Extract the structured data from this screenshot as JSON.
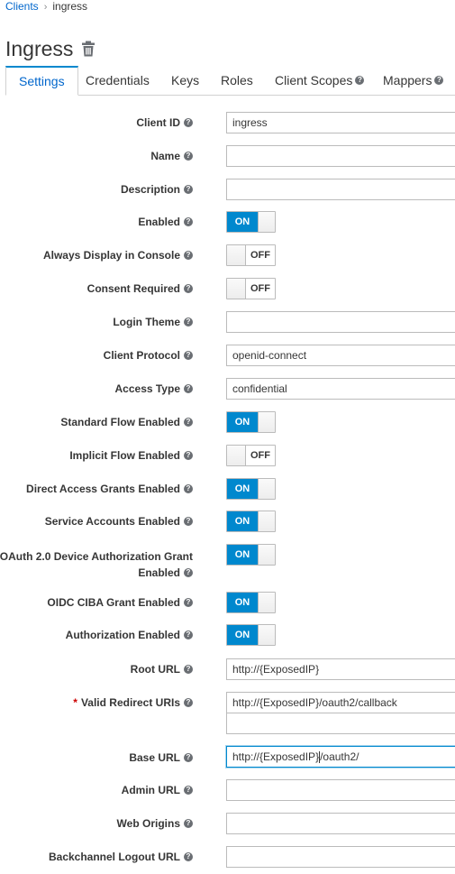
{
  "breadcrumb": {
    "parent": "Clients",
    "separator": "›",
    "current": "ingress"
  },
  "page": {
    "title": "Ingress"
  },
  "tabs": [
    {
      "label": "Settings",
      "active": true
    },
    {
      "label": "Credentials"
    },
    {
      "label": "Keys"
    },
    {
      "label": "Roles"
    },
    {
      "label": "Client Scopes",
      "help": true
    },
    {
      "label": "Mappers",
      "help": true
    }
  ],
  "help_glyph": "?",
  "form": {
    "client_id": {
      "label": "Client ID",
      "value": "ingress"
    },
    "name": {
      "label": "Name",
      "value": ""
    },
    "description": {
      "label": "Description",
      "value": ""
    },
    "enabled": {
      "label": "Enabled",
      "state": "ON"
    },
    "always_display": {
      "label": "Always Display in Console",
      "state": "OFF"
    },
    "consent_required": {
      "label": "Consent Required",
      "state": "OFF"
    },
    "login_theme": {
      "label": "Login Theme",
      "value": ""
    },
    "client_protocol": {
      "label": "Client Protocol",
      "value": "openid-connect"
    },
    "access_type": {
      "label": "Access Type",
      "value": "confidential"
    },
    "standard_flow": {
      "label": "Standard Flow Enabled",
      "state": "ON"
    },
    "implicit_flow": {
      "label": "Implicit Flow Enabled",
      "state": "OFF"
    },
    "direct_access": {
      "label": "Direct Access Grants Enabled",
      "state": "ON"
    },
    "service_accounts": {
      "label": "Service Accounts Enabled",
      "state": "ON"
    },
    "device_grant": {
      "label_line1": "OAuth 2.0 Device Authorization Grant",
      "label_line2": "Enabled",
      "state": "ON"
    },
    "ciba_grant": {
      "label": "OIDC CIBA Grant Enabled",
      "state": "ON"
    },
    "authorization": {
      "label": "Authorization Enabled",
      "state": "ON"
    },
    "root_url": {
      "label": "Root URL",
      "value": "http://{ExposedIP}"
    },
    "redirect_uris": {
      "required_mark": "*",
      "label": "Valid Redirect URIs",
      "value": "http://{ExposedIP}/oauth2/callback",
      "extra_value": ""
    },
    "base_url": {
      "label": "Base URL",
      "value_before_caret": "http://{ExposedIP}",
      "value_after_caret": "/oauth2/"
    },
    "admin_url": {
      "label": "Admin URL",
      "value": ""
    },
    "web_origins": {
      "label": "Web Origins",
      "value": ""
    },
    "backchannel_logout_url": {
      "label": "Backchannel Logout URL",
      "value": ""
    }
  },
  "colors": {
    "accent": "#0088ce",
    "link": "#0066cc",
    "required": "#cc0000"
  }
}
